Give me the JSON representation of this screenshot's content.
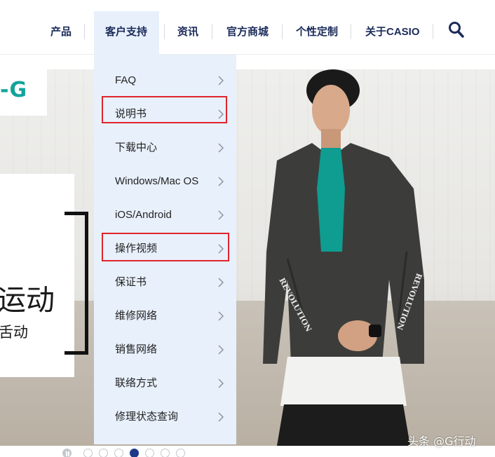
{
  "nav": {
    "items": [
      {
        "label": "产品"
      },
      {
        "label": "客户支持"
      },
      {
        "label": "资讯"
      },
      {
        "label": "官方商城"
      },
      {
        "label": "个性定制"
      },
      {
        "label": "关于CASIO"
      }
    ],
    "active_index": 1,
    "search_icon": "search-icon"
  },
  "dropdown": {
    "items": [
      {
        "label": "FAQ"
      },
      {
        "label": "说明书"
      },
      {
        "label": "下载中心"
      },
      {
        "label": "Windows/Mac OS"
      },
      {
        "label": "iOS/Android"
      },
      {
        "label": "操作视频"
      },
      {
        "label": "保证书"
      },
      {
        "label": "维修网络"
      },
      {
        "label": "销售网络"
      },
      {
        "label": "联络方式"
      },
      {
        "label": "修理状态查询"
      }
    ],
    "highlighted": [
      "说明书",
      "操作视频"
    ],
    "chevron_icon": "chevron-right-icon"
  },
  "banner": {
    "logo_text": "-G",
    "headline": "运动",
    "subline": "舌动"
  },
  "pagination": {
    "total_dots": 8,
    "active_index": 4,
    "first_is_pause": true
  },
  "watermark": "头条 @G行动",
  "colors": {
    "nav_text": "#1b2b5a",
    "dropdown_bg": "#e8f0fb",
    "highlight": "#e0242b",
    "logo": "#13a39b",
    "dot_active": "#1d3a8a"
  }
}
